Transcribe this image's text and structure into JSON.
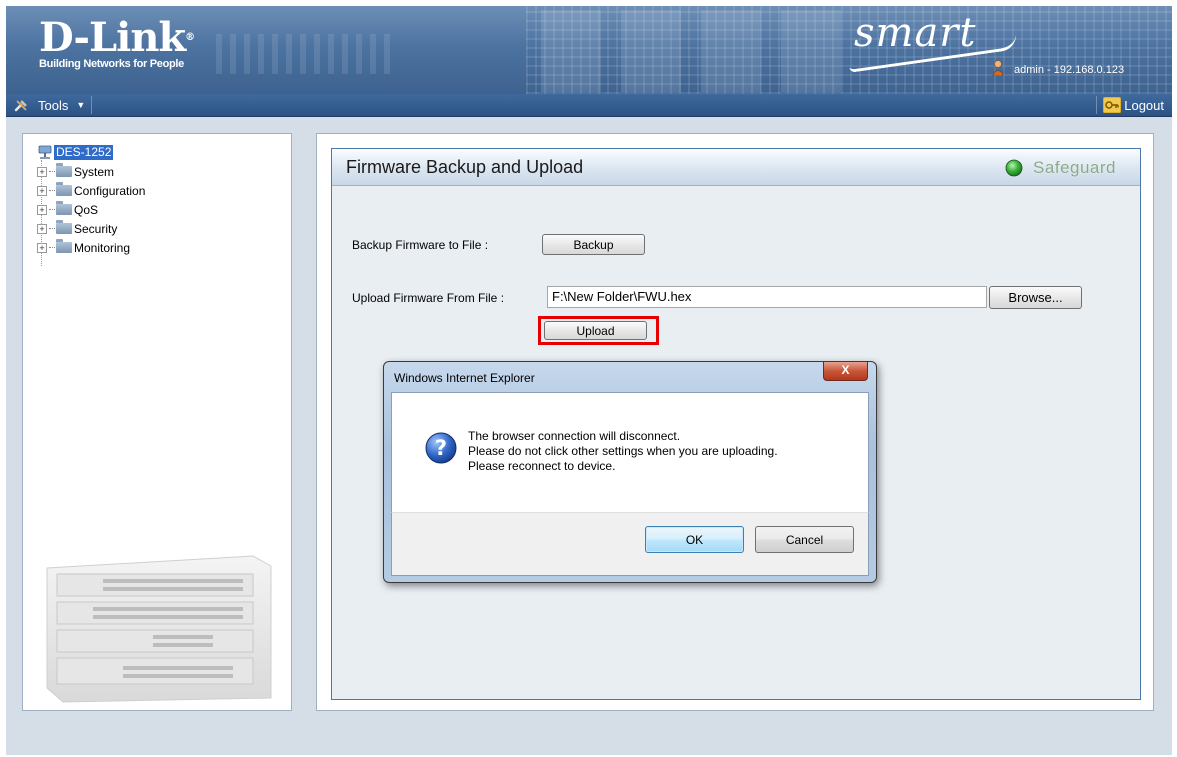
{
  "header": {
    "logo": "D-Link",
    "logo_trademark": "®",
    "tagline": "Building Networks for People",
    "smart_logo": "smart",
    "user_info": "admin - 192.168.0.123"
  },
  "toolbar": {
    "tools_label": "Tools",
    "logout_label": "Logout"
  },
  "tree": {
    "root": "DES-1252",
    "items": [
      {
        "label": "System"
      },
      {
        "label": "Configuration"
      },
      {
        "label": "QoS"
      },
      {
        "label": "Security"
      },
      {
        "label": "Monitoring"
      }
    ]
  },
  "main": {
    "title": "Firmware Backup and Upload",
    "safeguard_label": "Safeguard",
    "safeguard_color": "#2e9e2e",
    "backup_label": "Backup Firmware to File :",
    "backup_button": "Backup",
    "upload_label": "Upload Firmware From File :",
    "upload_file_value": "F:\\New Folder\\FWU.hex",
    "browse_button": "Browse...",
    "upload_button": "Upload",
    "highlight_color": "#e60000"
  },
  "dialog": {
    "title": "Windows Internet Explorer",
    "close_label": "X",
    "message_lines": [
      "The browser connection will disconnect.",
      "Please do not click other settings when you are uploading.",
      "Please reconnect to device."
    ],
    "ok_button": "OK",
    "cancel_button": "Cancel"
  }
}
